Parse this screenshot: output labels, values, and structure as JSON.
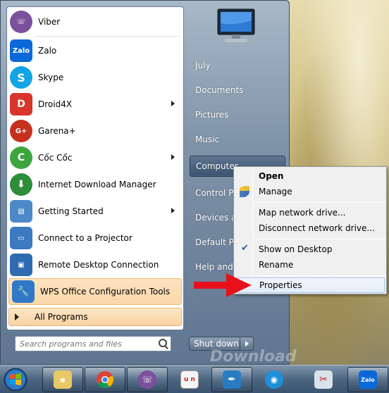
{
  "left_pane": {
    "programs": [
      {
        "label": "Viber",
        "icon": "viber-icon",
        "color": "#7b519d",
        "has_arrow": false
      },
      {
        "label": "Zalo",
        "icon": "zalo-icon",
        "color": "#0a68d8",
        "has_arrow": false
      },
      {
        "label": "Skype",
        "icon": "skype-icon",
        "color": "#12a5e6",
        "has_arrow": false
      },
      {
        "label": "Droid4X",
        "icon": "droid4x-icon",
        "color": "#d9352b",
        "has_arrow": true
      },
      {
        "label": "Garena+",
        "icon": "garena-icon",
        "color": "#c7301e",
        "has_arrow": false
      },
      {
        "label": "Cốc Cốc",
        "icon": "coccoc-icon",
        "color": "#3ea53e",
        "has_arrow": true
      },
      {
        "label": "Internet Download Manager",
        "icon": "idm-icon",
        "color": "#2d8d3b",
        "has_arrow": false
      },
      {
        "label": "Getting Started",
        "icon": "getting-started-icon",
        "color": "#4d89c9",
        "has_arrow": true
      },
      {
        "label": "Connect to a Projector",
        "icon": "projector-icon",
        "color": "#3b79c0",
        "has_arrow": false
      },
      {
        "label": "Remote Desktop Connection",
        "icon": "remote-desktop-icon",
        "color": "#2f6bb0",
        "has_arrow": false
      },
      {
        "label": "WPS Office Configuration Tools",
        "icon": "wps-tools-icon",
        "color": "#2f79c8",
        "has_arrow": false
      }
    ],
    "all_programs": "All Programs",
    "search_placeholder": "Search programs and files"
  },
  "right_pane": {
    "items": [
      "July",
      "Documents",
      "Pictures",
      "Music",
      "Computer",
      "Control Pa",
      "Devices an",
      "Default Pro",
      "Help and S"
    ],
    "shutdown_label": "Shut down"
  },
  "context_menu": {
    "items": [
      {
        "label": "Open",
        "bold": true
      },
      {
        "label": "Manage",
        "icon": "uac-shield-icon"
      },
      {
        "label": "Map network drive..."
      },
      {
        "label": "Disconnect network drive..."
      },
      {
        "label": "Show on Desktop",
        "checked": true
      },
      {
        "label": "Rename"
      },
      {
        "label": "Properties",
        "highlighted": true
      }
    ]
  },
  "taskbar": {
    "buttons": [
      "file-explorer-icon",
      "chrome-icon",
      "viber-icon",
      "unikey-icon",
      "feather-icon",
      "ubersocial-icon",
      "scissors-icon",
      "zalo-icon"
    ]
  },
  "watermark": "Download"
}
